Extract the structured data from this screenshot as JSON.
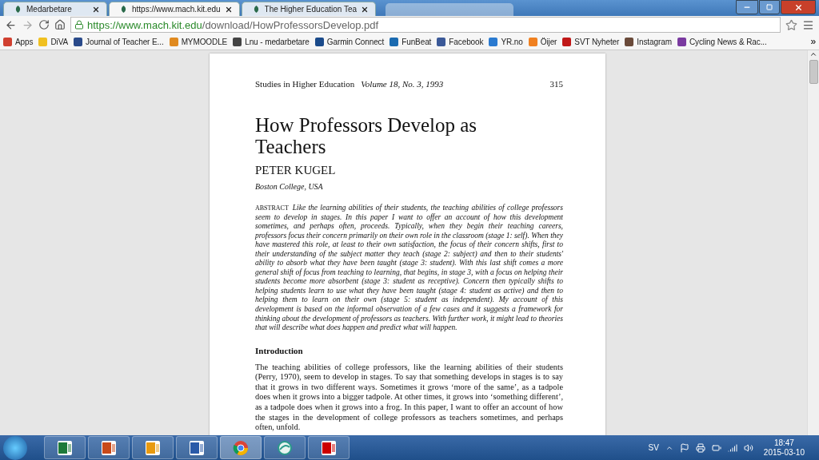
{
  "tabs": [
    {
      "kind": "page",
      "label": "Medarbetare",
      "selected": false
    },
    {
      "kind": "page",
      "label": "https://www.mach.kit.edu",
      "selected": true
    },
    {
      "kind": "page",
      "label": "The Higher Education Tea",
      "selected": false
    },
    {
      "kind": "blurred",
      "selected": false
    }
  ],
  "address": {
    "host": "https://www.mach.kit.edu",
    "path": "/download/HowProfessorsDevelop.pdf"
  },
  "bookmarks": [
    {
      "label": "Apps",
      "color": "#d04030"
    },
    {
      "label": "DiVA",
      "color": "#f0c020"
    },
    {
      "label": "Journal of Teacher E...",
      "color": "#2a4a8a"
    },
    {
      "label": "MYMOODLE",
      "color": "#e08a20"
    },
    {
      "label": "Lnu - medarbetare",
      "color": "#444444"
    },
    {
      "label": "Garmin Connect",
      "color": "#1a4a8a"
    },
    {
      "label": "FunBeat",
      "color": "#1a6ab0"
    },
    {
      "label": "Facebook",
      "color": "#3b5998"
    },
    {
      "label": "YR.no",
      "color": "#2a7ad0"
    },
    {
      "label": "Öijer",
      "color": "#f08020"
    },
    {
      "label": "SVT Nyheter",
      "color": "#c01818"
    },
    {
      "label": "Instagram",
      "color": "#6a4a3a"
    },
    {
      "label": "Cycling News & Rac...",
      "color": "#7a3aa0"
    }
  ],
  "bookmarks_more": "»",
  "document": {
    "journal": "Studies in Higher Education",
    "volume": "Volume 18, No. 3, 1993",
    "page_number": "315",
    "title": "How Professors Develop as Teachers",
    "author": "PETER KUGEL",
    "affiliation": "Boston College, USA",
    "abstract_label": "ABSTRACT",
    "abstract": "Like the learning abilities of their students, the teaching abilities of college professors seem to develop in stages. In this paper I want to offer an account of how this development sometimes, and perhaps often, proceeds. Typically, when they begin their teaching careers, professors focus their concern primarily on their own role in the classroom (stage 1: self). When they have mastered this role, at least to their own satisfaction, the focus of their concern shifts, first to their understanding of the subject matter they teach (stage 2: subject) and then to their students' ability to absorb what they have been taught (stage 3: student). With this last shift comes a more general shift of focus from teaching to learning, that begins, in stage 3, with a focus on helping their students become more absorbent (stage 3: student as receptive). Concern then typically shifts to helping students learn to use what they have been taught (stage 4: student as active) and then to helping them to learn on their own (stage 5: student as independent). My account of this development is based on the informal observation of a few cases and it suggests a framework for thinking about the development of professors as teachers. With further work, it might lead to theories that will describe what does happen and predict what will happen.",
    "section_heading": "Introduction",
    "intro": "The teaching abilities of college professors, like the learning abilities of their students (Perry, 1970), seem to develop in stages. To say that something develops in stages is to say that it grows in two different ways. Sometimes it grows ‘more of the same’, as a tadpole does when it grows into a bigger tadpole. At other times, it grows into ‘something different’, as a tadpole does when it grows into a frog. In this paper, I want to offer an account of how the stages in the development of college professors as teachers sometimes, and perhaps often, unfold."
  },
  "taskbar": {
    "apps": [
      {
        "kind": "excel",
        "selected": false
      },
      {
        "kind": "powerpoint",
        "selected": false
      },
      {
        "kind": "outlook",
        "selected": false
      },
      {
        "kind": "word",
        "selected": false
      },
      {
        "kind": "chrome",
        "selected": true
      },
      {
        "kind": "globe",
        "selected": false
      },
      {
        "kind": "acrobat",
        "selected": false
      }
    ],
    "language": "SV",
    "time": "18:47",
    "date": "2015-03-10"
  }
}
